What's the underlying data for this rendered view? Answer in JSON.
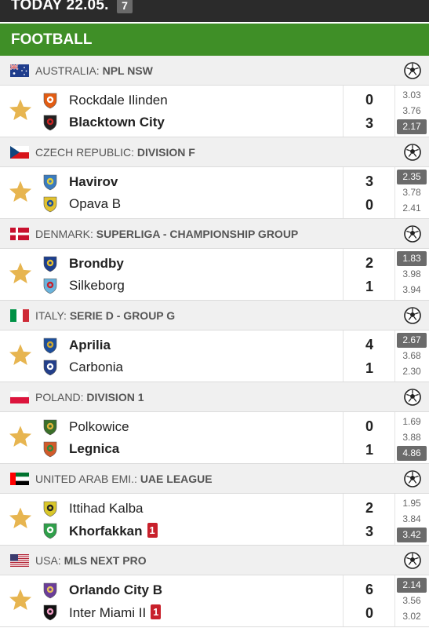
{
  "topbar": {
    "title": "TODAY 22.05.",
    "count": "7"
  },
  "sport": {
    "title": "FOOTBALL"
  },
  "sections": [
    {
      "flag": "australia-flag",
      "country": "AUSTRALIA: ",
      "league": "NPL NSW",
      "home": {
        "name": "Rockdale Ilinden",
        "score": "0",
        "winner": false,
        "red_cards": ""
      },
      "away": {
        "name": "Blacktown City",
        "score": "3",
        "winner": true,
        "red_cards": ""
      },
      "odds": [
        "3.03",
        "3.76",
        "2.17"
      ],
      "fav": 2
    },
    {
      "flag": "czech-flag",
      "country": "CZECH REPUBLIC: ",
      "league": "DIVISION F",
      "home": {
        "name": "Havirov",
        "score": "3",
        "winner": true,
        "red_cards": ""
      },
      "away": {
        "name": "Opava B",
        "score": "0",
        "winner": false,
        "red_cards": ""
      },
      "odds": [
        "2.35",
        "3.78",
        "2.41"
      ],
      "fav": 0
    },
    {
      "flag": "denmark-flag",
      "country": "DENMARK: ",
      "league": "SUPERLIGA - CHAMPIONSHIP GROUP",
      "home": {
        "name": "Brondby",
        "score": "2",
        "winner": true,
        "red_cards": ""
      },
      "away": {
        "name": "Silkeborg",
        "score": "1",
        "winner": false,
        "red_cards": ""
      },
      "odds": [
        "1.83",
        "3.98",
        "3.94"
      ],
      "fav": 0
    },
    {
      "flag": "italy-flag",
      "country": "ITALY: ",
      "league": "SERIE D - GROUP G",
      "home": {
        "name": "Aprilia",
        "score": "4",
        "winner": true,
        "red_cards": ""
      },
      "away": {
        "name": "Carbonia",
        "score": "1",
        "winner": false,
        "red_cards": ""
      },
      "odds": [
        "2.67",
        "3.68",
        "2.30"
      ],
      "fav": 0
    },
    {
      "flag": "poland-flag",
      "country": "POLAND: ",
      "league": "DIVISION 1",
      "home": {
        "name": "Polkowice",
        "score": "0",
        "winner": false,
        "red_cards": ""
      },
      "away": {
        "name": "Legnica",
        "score": "1",
        "winner": true,
        "red_cards": ""
      },
      "odds": [
        "1.69",
        "3.88",
        "4.86"
      ],
      "fav": 2
    },
    {
      "flag": "uae-flag",
      "country": "UNITED ARAB EMI.: ",
      "league": "UAE LEAGUE",
      "home": {
        "name": "Ittihad Kalba",
        "score": "2",
        "winner": false,
        "red_cards": ""
      },
      "away": {
        "name": "Khorfakkan",
        "score": "3",
        "winner": true,
        "red_cards": "1"
      },
      "odds": [
        "1.95",
        "3.84",
        "3.42"
      ],
      "fav": 2
    },
    {
      "flag": "usa-flag",
      "country": "USA: ",
      "league": "MLS NEXT PRO",
      "home": {
        "name": "Orlando City B",
        "score": "6",
        "winner": true,
        "red_cards": ""
      },
      "away": {
        "name": "Inter Miami II",
        "score": "0",
        "winner": false,
        "red_cards": "1"
      },
      "odds": [
        "2.14",
        "3.56",
        "3.02"
      ],
      "fav": 0
    }
  ],
  "colors": {
    "header_green": "#3f8f27",
    "topbar": "#2b2b2b",
    "star": "#e7b550",
    "red_card": "#c8202b",
    "fav_odd": "#6b6b6b"
  }
}
